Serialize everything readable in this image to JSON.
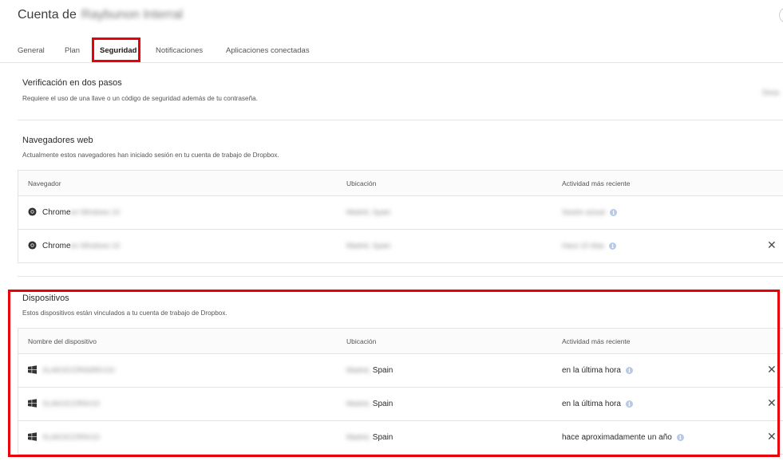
{
  "header": {
    "title_prefix": "Cuenta de",
    "account_name": "Raybunon Interral"
  },
  "tabs": [
    {
      "label": "General"
    },
    {
      "label": "Plan"
    },
    {
      "label": "Seguridad",
      "active": true
    },
    {
      "label": "Notificaciones"
    },
    {
      "label": "Aplicaciones conectadas"
    }
  ],
  "two_step": {
    "title": "Verificación en dos pasos",
    "description": "Requiere el uso de una llave o un código de seguridad además de tu contraseña.",
    "status": "Desa"
  },
  "browsers": {
    "title": "Navegadores web",
    "description": "Actualmente estos navegadores han iniciado sesión en tu cuenta de trabajo de Dropbox.",
    "columns": [
      "Navegador",
      "Ubicación",
      "Actividad más reciente"
    ],
    "rows": [
      {
        "browser": "Chrome",
        "browser_detail": "en Windows 10",
        "location": "Madrid, Spain",
        "activity": "Sesión actual",
        "removable": false
      },
      {
        "browser": "Chrome",
        "browser_detail": "en Windows 10",
        "location": "Madrid, Spain",
        "activity": "Hace 10 días",
        "removable": true
      }
    ]
  },
  "devices": {
    "title": "Dispositivos",
    "description": "Estos dispositivos están vinculados a tu cuenta de trabajo de Dropbox.",
    "columns": [
      "Nombre del dispositivo",
      "Ubicación",
      "Actividad más reciente"
    ],
    "rows": [
      {
        "name": "XLAKOCCRNSRKV10",
        "location_prefix": "Madrid,",
        "location": "Spain",
        "activity": "en la última hora"
      },
      {
        "name": "XLAKOCCRNV10",
        "location_prefix": "Madrid,",
        "location": "Spain",
        "activity": "en la última hora"
      },
      {
        "name": "XLAKOCCRNV10",
        "location_prefix": "Madrid,",
        "location": "Spain",
        "activity": "hace aproximadamente un año"
      }
    ]
  },
  "colors": {
    "highlight": "#e8000b",
    "info_icon": "#b8c9e6"
  },
  "icons": {
    "browser": "chrome-icon",
    "device": "windows-icon",
    "info": "info-icon",
    "remove": "close-icon"
  }
}
